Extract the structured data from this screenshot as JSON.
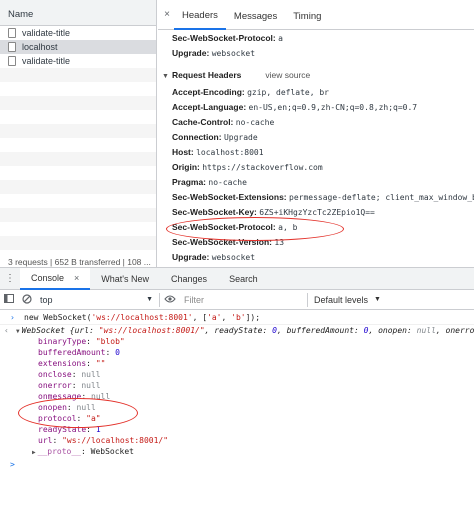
{
  "network": {
    "name_header": "Name",
    "requests": [
      "validate-title",
      "localhost",
      "validate-title"
    ],
    "status": "3 requests | 652 B transferred | 108 ..."
  },
  "details": {
    "close": "×",
    "tabs": [
      "Headers",
      "Messages",
      "Timing"
    ],
    "headers_top": [
      {
        "name": "Sec-WebSocket-Protocol:",
        "value": "a"
      },
      {
        "name": "Upgrade:",
        "value": "websocket"
      }
    ],
    "request_section": "Request Headers",
    "view_source": "view source",
    "request_headers": [
      {
        "name": "Accept-Encoding:",
        "value": "gzip, deflate, br"
      },
      {
        "name": "Accept-Language:",
        "value": "en-US,en;q=0.9,zh-CN;q=0.8,zh;q=0.7"
      },
      {
        "name": "Cache-Control:",
        "value": "no-cache"
      },
      {
        "name": "Connection:",
        "value": "Upgrade"
      },
      {
        "name": "Host:",
        "value": "localhost:8001"
      },
      {
        "name": "Origin:",
        "value": "https://stackoverflow.com"
      },
      {
        "name": "Pragma:",
        "value": "no-cache"
      },
      {
        "name": "Sec-WebSocket-Extensions:",
        "value": "permessage-deflate; client_max_window_b"
      },
      {
        "name": "Sec-WebSocket-Key:",
        "value": "6ZS+iKHgzYzcTc2ZEpio1Q=="
      },
      {
        "name": "Sec-WebSocket-Protocol:",
        "value": "a, b"
      },
      {
        "name": "Sec-WebSocket-Version:",
        "value": "13"
      },
      {
        "name": "Upgrade:",
        "value": "websocket"
      }
    ]
  },
  "drawer": {
    "tabs": [
      "Console",
      "What's New",
      "Changes",
      "Search"
    ],
    "close": "×",
    "context": "top",
    "filter_placeholder": "Filter",
    "levels": "Default levels"
  },
  "console": {
    "input_prefix": "new WebSocket(",
    "input_url": "'ws://localhost:8001'",
    "input_mid": ", [",
    "input_a": "'a'",
    "input_comma": ", ",
    "input_b": "'b'",
    "input_suffix": "]);",
    "obj_name": "WebSocket",
    "obj_open": " {url: ",
    "obj_url": "\"ws://localhost:8001/\"",
    "obj_rest1": ", readyState: ",
    "obj_rs": "0",
    "obj_rest2": ", bufferedAmount: ",
    "obj_ba": "0",
    "obj_rest3": ", onopen: ",
    "obj_null1": "null",
    "obj_rest4": ", onerror:",
    "props": [
      {
        "key": "binaryType",
        "value": "\"blob\"",
        "kind": "s"
      },
      {
        "key": "bufferedAmount",
        "value": "0",
        "kind": "n"
      },
      {
        "key": "extensions",
        "value": "\"\"",
        "kind": "s"
      },
      {
        "key": "onclose",
        "value": "null",
        "kind": "g"
      },
      {
        "key": "onerror",
        "value": "null",
        "kind": "g"
      },
      {
        "key": "onmessage",
        "value": "null",
        "kind": "g"
      },
      {
        "key": "onopen",
        "value": "null",
        "kind": "g"
      },
      {
        "key": "protocol",
        "value": "\"a\"",
        "kind": "s"
      },
      {
        "key": "readyState",
        "value": "1",
        "kind": "n"
      },
      {
        "key": "url",
        "value": "\"ws://localhost:8001/\"",
        "kind": "s"
      }
    ],
    "proto_key": "__proto__",
    "proto_value": "WebSocket",
    "prompt": ">"
  },
  "colors": {
    "accent": "#1a73e8",
    "highlight_oval": "#e3312a"
  }
}
